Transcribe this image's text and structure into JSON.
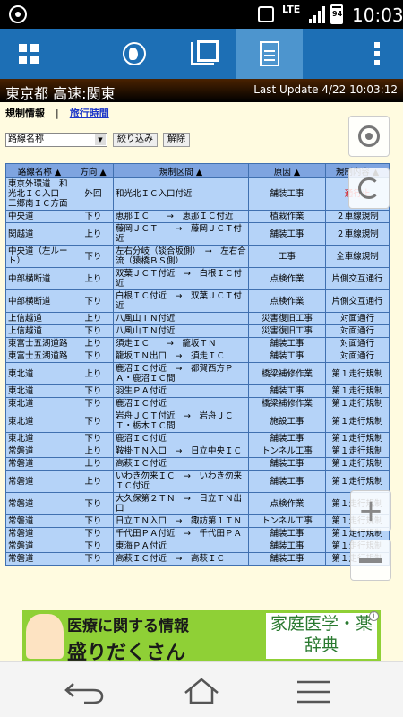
{
  "status_bar": {
    "network": "LTE",
    "battery": "94",
    "time": "10:03"
  },
  "header": {
    "title": "東京都 高速:関東",
    "last_update": "Last Update 4/22 10:03:12"
  },
  "subnav": {
    "current": "規制情報",
    "separator": "|",
    "link": "旅行時間"
  },
  "controls": {
    "select_value": "路線名称",
    "narrow_button": "絞り込み",
    "clear_button": "解除"
  },
  "table": {
    "columns": [
      "路線名称 ▲",
      "方向 ▲",
      "規制区間 ▲",
      "原因 ▲",
      "規制内容 ▲"
    ],
    "rows": [
      [
        "東京外環道　和光北ＩＣ入口　三郷南ＩＣ方面",
        "外回",
        "和光北ＩＣ入口付近",
        "舗装工事",
        "通行止"
      ],
      [
        "中央道",
        "下り",
        "恵那ＩＣ　　→　恵那ＩＣ付近",
        "植栽作業",
        "２車線規制"
      ],
      [
        "関越道",
        "上り",
        "藤岡ＪＣＴ　　→　藤岡ＪＣＴ付近",
        "舗装工事",
        "２車線規制"
      ],
      [
        "中央道（左ルート）",
        "下り",
        "左右分岐（談合坂側）　→　左右合流（猿橋ＢＳ側）",
        "工事",
        "全車線規制"
      ],
      [
        "中部横断道",
        "上り",
        "双葉ＪＣＴ付近　→　白根ＩＣ付近",
        "点検作業",
        "片側交互通行"
      ],
      [
        "中部横断道",
        "下り",
        "白根ＩＣ付近　→　双葉ＪＣＴ付近",
        "点検作業",
        "片側交互通行"
      ],
      [
        "上信越道",
        "上り",
        "八風山ＴＮ付近",
        "災害復旧工事",
        "対面通行"
      ],
      [
        "上信越道",
        "下り",
        "八風山ＴＮ付近",
        "災害復旧工事",
        "対面通行"
      ],
      [
        "東富士五湖道路",
        "上り",
        "須走ＩＣ　　→　籠坂ＴＮ",
        "舗装工事",
        "対面通行"
      ],
      [
        "東富士五湖道路",
        "下り",
        "籠坂ＴＮ出口　→　須走ＩＣ",
        "舗装工事",
        "対面通行"
      ],
      [
        "東北道",
        "上り",
        "鹿沼ＩＣ付近　→　都賀西方ＰＡ・鹿沼ＩＣ間",
        "橋梁補修作業",
        "第１走行規制"
      ],
      [
        "東北道",
        "下り",
        "羽生ＰＡ付近",
        "舗装工事",
        "第１走行規制"
      ],
      [
        "東北道",
        "下り",
        "鹿沼ＩＣ付近",
        "橋梁補修作業",
        "第１走行規制"
      ],
      [
        "東北道",
        "下り",
        "岩舟ＪＣＴ付近　→　岩舟ＪＣＴ・栃木ＩＣ間",
        "施設工事",
        "第１走行規制"
      ],
      [
        "東北道",
        "下り",
        "鹿沼ＩＣ付近",
        "舗装工事",
        "第１走行規制"
      ],
      [
        "常磐道",
        "上り",
        "鞍掛ＴＮ入口　→　日立中央ＩＣ",
        "トンネル工事",
        "第１走行規制"
      ],
      [
        "常磐道",
        "上り",
        "高萩ＩＣ付近",
        "舗装工事",
        "第１走行規制"
      ],
      [
        "常磐道",
        "上り",
        "いわき勿来ＩＣ　→　いわき勿来ＩＣ付近",
        "舗装工事",
        "第１走行規制"
      ],
      [
        "常磐道",
        "下り",
        "大久保第２ＴＮ　→　日立ＴＮ出口",
        "点検作業",
        "第１走行規制"
      ],
      [
        "常磐道",
        "下り",
        "日立ＴＮ入口　→　諏訪第１ＴＮ",
        "トンネル工事",
        "第１走行規制"
      ],
      [
        "常磐道",
        "下り",
        "千代田ＰＡ付近　→　千代田ＰＡ",
        "舗装工事",
        "第１走行規制"
      ],
      [
        "常磐道",
        "下り",
        "東海ＰＡ付近",
        "舗装工事",
        "第１走行規制"
      ],
      [
        "常磐道",
        "下り",
        "高萩ＩＣ付近　→　高萩ＩＣ",
        "舗装工事",
        "第１走行規制"
      ]
    ]
  },
  "ad": {
    "line1": "医療に関する情報",
    "line2": "盛りだくさん",
    "right": "家庭医学・薬辞典"
  },
  "colors": {
    "toolbar": "#1d6fb5",
    "page_bg": "#fffbe0",
    "table_header": "#7ea4e0",
    "table_cell": "#b5d3f8",
    "alert_text": "#e00000"
  }
}
